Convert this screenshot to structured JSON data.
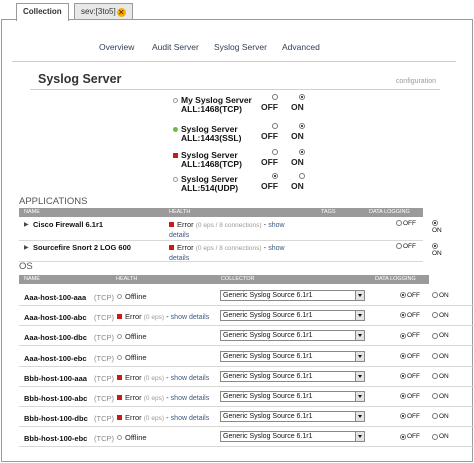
{
  "tabs": [
    {
      "label": "Collection",
      "active": true
    },
    {
      "label": "sev:[3to5]",
      "active": false
    }
  ],
  "nav": [
    "Overview",
    "Audit Server",
    "Syslog Server",
    "Advanced"
  ],
  "syslog": {
    "title": "Syslog Server",
    "configuration_link": "configuration",
    "off_label": "OFF",
    "on_label": "ON",
    "servers": [
      {
        "name": "My Syslog Server ALL:1468(TCP)",
        "status": "gray",
        "state": "on"
      },
      {
        "name": "Syslog Server ALL:1443(SSL)",
        "status": "green",
        "state": "on"
      },
      {
        "name": "Syslog Server ALL:1468(TCP)",
        "status": "red",
        "state": "on"
      },
      {
        "name": "Syslog Server ALL:514(UDP)",
        "status": "gray",
        "state": "off"
      }
    ]
  },
  "applications": {
    "label": "APPLICATIONS",
    "headers": {
      "name": "NAME",
      "health": "HEALTH",
      "tags": "TAGS",
      "logging": "DATA LOGGING"
    },
    "rows": [
      {
        "name": "Cisco Firewall 6.1r1",
        "health": "Error",
        "detail": "(0 eps / 8 connections)",
        "link": "show details",
        "logging": "on"
      },
      {
        "name": "Sourcefire Snort 2 LOG 600",
        "health": "Error",
        "detail": "(0 eps / 8 connections)",
        "link": "show details",
        "logging": "on"
      }
    ]
  },
  "os": {
    "label": "OS",
    "headers": {
      "name": "NAME",
      "health": "HEALTH",
      "collector": "COLLECTOR",
      "logging": "DATA LOGGING"
    },
    "off_label": "OFF",
    "on_label": "ON",
    "rows": [
      {
        "name": "Aaa-host-100-aaa",
        "proto": "(TCP)",
        "health": "Offline",
        "detail": "",
        "link": "",
        "collector": "Generic Syslog Source 6.1r1",
        "logging": "off"
      },
      {
        "name": "Aaa-host-100-abc",
        "proto": "(TCP)",
        "health": "Error",
        "detail": "(0 eps)",
        "link": "show details",
        "collector": "Generic Syslog Source 6.1r1",
        "logging": "off"
      },
      {
        "name": "Aaa-host-100-dbc",
        "proto": "(TCP)",
        "health": "Offline",
        "detail": "",
        "link": "",
        "collector": "Generic Syslog Source 6.1r1",
        "logging": "off"
      },
      {
        "name": "Aaa-host-100-ebc",
        "proto": "(TCP)",
        "health": "Offline",
        "detail": "",
        "link": "",
        "collector": "Generic Syslog Source 6.1r1",
        "logging": "off"
      },
      {
        "name": "Bbb-host-100-aaa",
        "proto": "(TCP)",
        "health": "Error",
        "detail": "(0 eps)",
        "link": "show details",
        "collector": "Generic Syslog Source 6.1r1",
        "logging": "off"
      },
      {
        "name": "Bbb-host-100-abc",
        "proto": "(TCP)",
        "health": "Error",
        "detail": "(0 eps)",
        "link": "show details",
        "collector": "Generic Syslog Source 6.1r1",
        "logging": "off"
      },
      {
        "name": "Bbb-host-100-dbc",
        "proto": "(TCP)",
        "health": "Error",
        "detail": "(0 eps)",
        "link": "show details",
        "collector": "Generic Syslog Source 6.1r1",
        "logging": "off"
      },
      {
        "name": "Bbb-host-100-ebc",
        "proto": "(TCP)",
        "health": "Offline",
        "detail": "",
        "link": "",
        "collector": "Generic Syslog Source 6.1r1",
        "logging": "off"
      }
    ]
  },
  "colors": {
    "error": "#cc1818",
    "ok": "#6cbd45",
    "header": "#9a9a9a"
  },
  "icons": [
    "close-icon",
    "status-dot-icon",
    "error-square-icon",
    "offline-circle-icon",
    "expand-arrow-icon",
    "dropdown-arrow-icon"
  ]
}
